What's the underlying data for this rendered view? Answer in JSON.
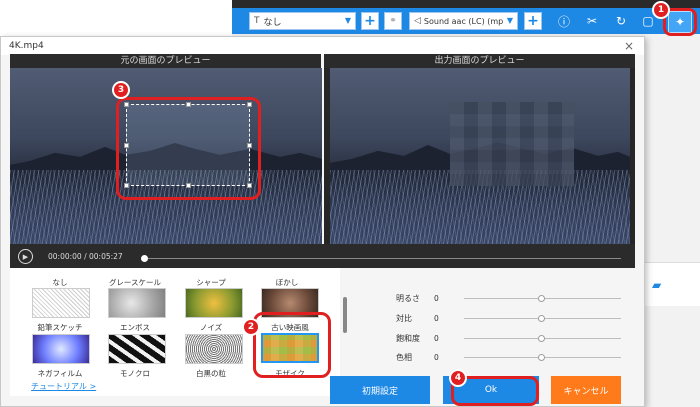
{
  "toolbar": {
    "subtitle_label": "なし",
    "audio_label": "Sound aac (LC) (mp",
    "add_icon": "+",
    "effects_icon": "magic-wand"
  },
  "dialog": {
    "title": "4K.mp4",
    "close_icon": "×",
    "left_preview_header": "元の画面のプレビュー",
    "right_preview_header": "出力画面のプレビュー",
    "time_current": "00:00:00",
    "time_sep": "/",
    "time_total": "00:05:27"
  },
  "filters": [
    {
      "name": "なし",
      "label_top": "なし",
      "label_bottom": "鉛筆スケッチ"
    },
    {
      "name": "グレースケール",
      "label_top": "グレースケール",
      "label_bottom": "エンボス"
    },
    {
      "name": "シャープ",
      "label_top": "シャープ",
      "label_bottom": "ノイズ"
    },
    {
      "name": "ぼかし",
      "label_top": "ぼかし",
      "label_bottom": "古い映画風"
    },
    {
      "label_bottom": "ネガフィルム"
    },
    {
      "label_bottom": "モノクロ"
    },
    {
      "label_bottom": "白黒の粒"
    },
    {
      "label_bottom": "モザイク"
    }
  ],
  "adjust": [
    {
      "label": "明るさ",
      "value": "0"
    },
    {
      "label": "対比",
      "value": "0"
    },
    {
      "label": "飽和度",
      "value": "0"
    },
    {
      "label": "色相",
      "value": "0"
    }
  ],
  "tutorial_link": "チュートリアル >",
  "buttons": {
    "reset": "初期設定",
    "ok": "Ok",
    "cancel": "キャンセル"
  },
  "callouts": [
    "1",
    "2",
    "3",
    "4"
  ],
  "colors": {
    "accent": "#1e88e5",
    "cancel": "#ff7a1a",
    "highlight": "#e02020"
  }
}
